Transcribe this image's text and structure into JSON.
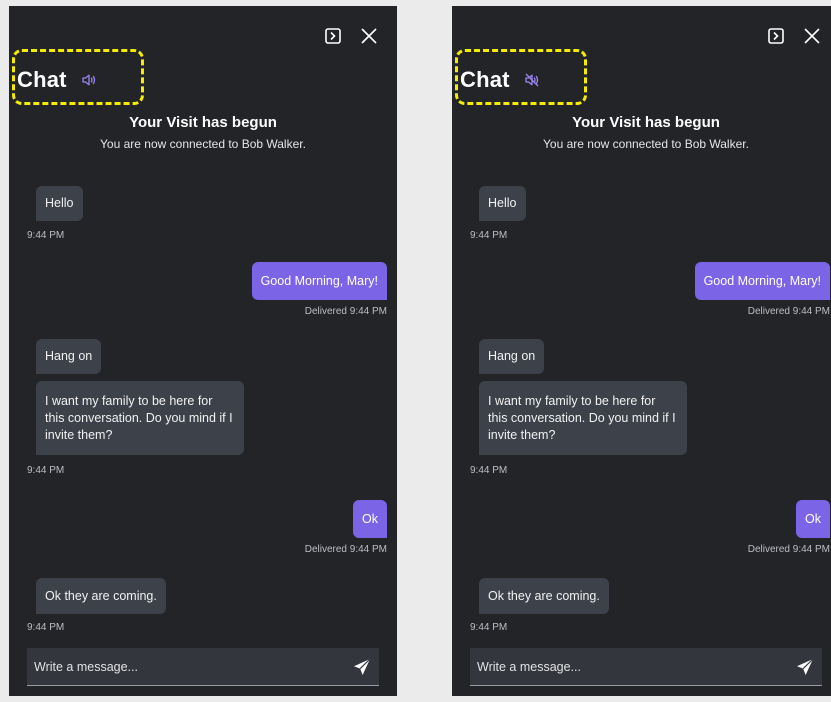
{
  "colors": {
    "background": "#ebebeb",
    "panel": "#222428",
    "incoming_bubble": "#3d4149",
    "outgoing_bubble": "#7b64e5",
    "accent": "#9b85f0",
    "highlight": "#f5ec00"
  },
  "icons": {
    "sidebar_toggle": "sidebar-toggle-icon",
    "close": "close-icon",
    "sound_on": "speaker-on-icon",
    "sound_muted": "speaker-muted-icon",
    "send": "send-icon"
  },
  "panels": {
    "left": {
      "title": "Chat",
      "sound_state": "on",
      "visit_title": "Your Visit has begun",
      "visit_subtitle": "You are now connected to Bob Walker.",
      "messages": [
        {
          "text": "Hello",
          "meta": "9:44 PM"
        },
        {
          "text": "Good Morning, Mary!",
          "meta": "Delivered  9:44 PM"
        },
        {
          "text": "Hang on"
        },
        {
          "text": "I want my family to be here for this conversation. Do you mind if I invite them?",
          "meta": "9:44 PM"
        },
        {
          "text": "Ok",
          "meta": "Delivered  9:44 PM"
        },
        {
          "text": "Ok they are coming.",
          "meta": "9:44 PM"
        }
      ],
      "composer_placeholder": "Write a message..."
    },
    "right": {
      "title": "Chat",
      "sound_state": "muted",
      "visit_title": "Your Visit has begun",
      "visit_subtitle": "You are now connected to Bob Walker.",
      "messages": [
        {
          "text": "Hello",
          "meta": "9:44 PM"
        },
        {
          "text": "Good Morning, Mary!",
          "meta": "Delivered  9:44 PM"
        },
        {
          "text": "Hang on"
        },
        {
          "text": "I want my family to be here for this conversation. Do you mind if I invite them?",
          "meta": "9:44 PM"
        },
        {
          "text": "Ok",
          "meta": "Delivered  9:44 PM"
        },
        {
          "text": "Ok they are coming.",
          "meta": "9:44 PM"
        }
      ],
      "composer_placeholder": "Write a message..."
    }
  }
}
